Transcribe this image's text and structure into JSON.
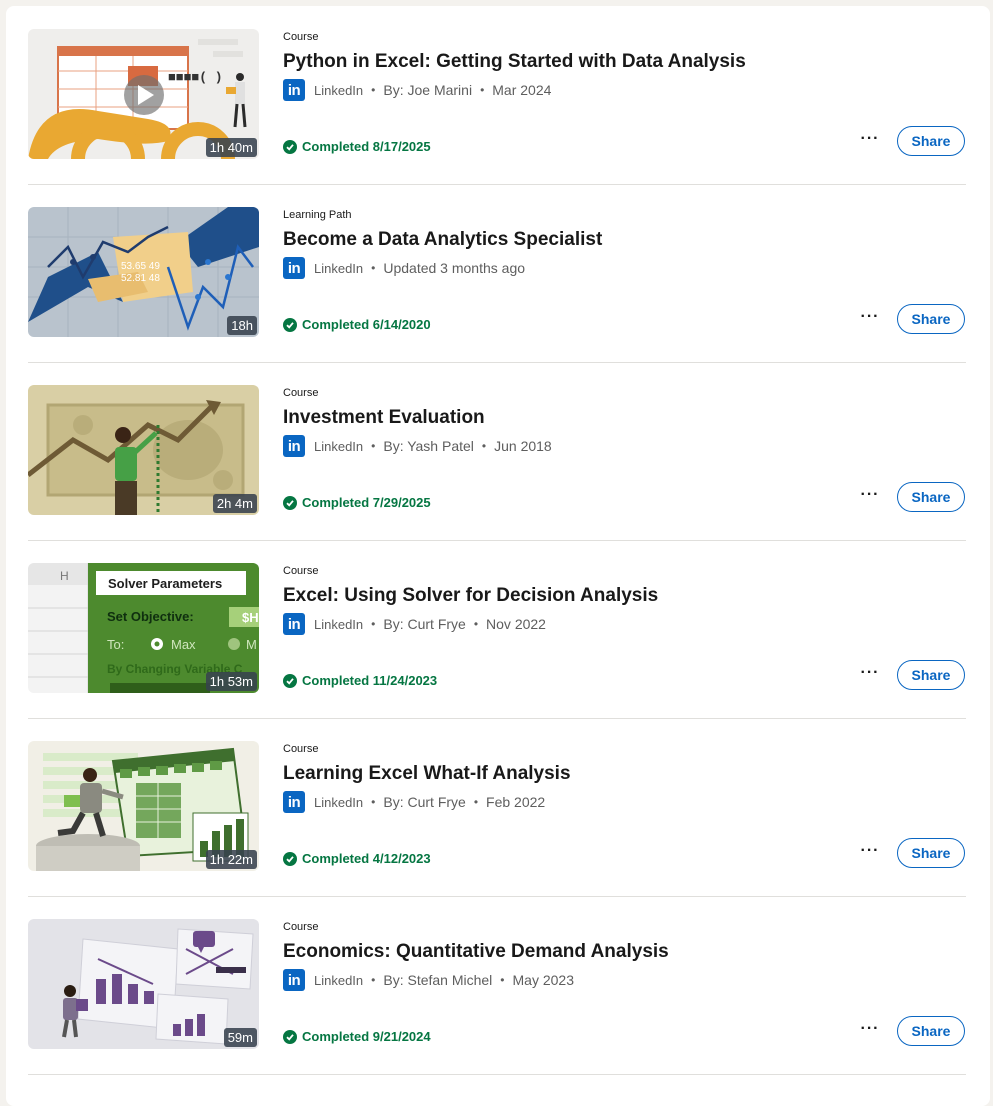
{
  "items": [
    {
      "kind": "Course",
      "title": "Python in Excel: Getting Started with Data Analysis",
      "provider": "LinkedIn",
      "meta1": "By: Joe Marini",
      "meta2": "Mar 2024",
      "duration": "1h 40m",
      "status": "Completed 8/17/2025",
      "share": "Share",
      "more": "···"
    },
    {
      "kind": "Learning Path",
      "title": "Become a Data Analytics Specialist",
      "provider": "LinkedIn",
      "meta1": "Updated 3 months ago",
      "duration": "18h",
      "status": "Completed 6/14/2020",
      "share": "Share",
      "more": "···"
    },
    {
      "kind": "Course",
      "title": "Investment Evaluation",
      "provider": "LinkedIn",
      "meta1": "By: Yash Patel",
      "meta2": "Jun 2018",
      "duration": "2h 4m",
      "status": "Completed 7/29/2025",
      "share": "Share",
      "more": "···"
    },
    {
      "kind": "Course",
      "title": "Excel: Using Solver for Decision Analysis",
      "provider": "LinkedIn",
      "meta1": "By: Curt Frye",
      "meta2": "Nov 2022",
      "duration": "1h 53m",
      "status": "Completed 11/24/2023",
      "share": "Share",
      "more": "···"
    },
    {
      "kind": "Course",
      "title": "Learning Excel What-If Analysis",
      "provider": "LinkedIn",
      "meta1": "By: Curt Frye",
      "meta2": "Feb 2022",
      "duration": "1h 22m",
      "status": "Completed 4/12/2023",
      "share": "Share",
      "more": "···"
    },
    {
      "kind": "Course",
      "title": "Economics: Quantitative Demand Analysis",
      "provider": "LinkedIn",
      "meta1": "By: Stefan Michel",
      "meta2": "May 2023",
      "duration": "59m",
      "status": "Completed 9/21/2024",
      "share": "Share",
      "more": "···"
    }
  ],
  "thumb_text": {
    "python_code": "■■■■( )",
    "numbers_1": "53.65 49",
    "numbers_2": "52.81 48",
    "solver_header": "H",
    "solver_title": "Solver Parameters",
    "solver_objective": "Set Objective:",
    "solver_cell": "$H",
    "solver_to": "To:",
    "solver_max": "Max",
    "solver_min": "M",
    "solver_changing": "By Changing Variable C"
  },
  "colors": {
    "brand": "#0a66c2",
    "success": "#057642"
  },
  "icons": {
    "provider": "linkedin-logo-icon",
    "status": "check-circle-icon",
    "more": "more-horizontal-icon"
  }
}
